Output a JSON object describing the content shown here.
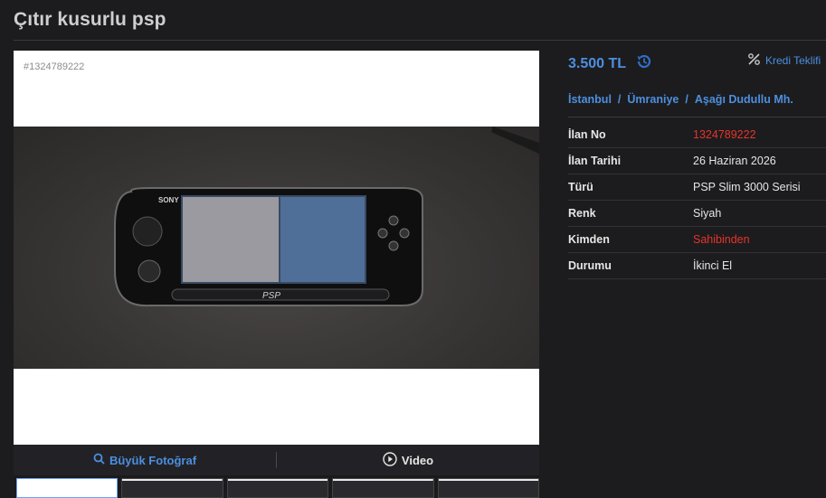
{
  "listing": {
    "title": "Çıtır kusurlu psp",
    "photo_id": "#1324789222",
    "price": "3.500 TL",
    "credit_offer": "Kredi Teklifi",
    "location": {
      "city": "İstanbul",
      "district": "Ümraniye",
      "neighborhood": "Aşağı Dudullu Mh."
    },
    "details": [
      {
        "key": "İlan No",
        "value": "1324789222",
        "highlight": true
      },
      {
        "key": "İlan Tarihi",
        "value": "26 Haziran 2026",
        "highlight": false
      },
      {
        "key": "Türü",
        "value": "PSP Slim 3000 Serisi",
        "highlight": false
      },
      {
        "key": "Renk",
        "value": "Siyah",
        "highlight": false
      },
      {
        "key": "Kimden",
        "value": "Sahibinden",
        "highlight": true
      },
      {
        "key": "Durumu",
        "value": "İkinci El",
        "highlight": false
      }
    ]
  },
  "photo_tabs": {
    "zoom_label": "Büyük Fotoğraf",
    "video_label": "Video"
  },
  "photo_image": {
    "brand_text": "SONY",
    "logo_text": "PSP"
  },
  "icons": {
    "price_history": "history-icon",
    "credit": "percent-icon",
    "zoom": "magnifier-icon",
    "video": "play-icon"
  },
  "colors": {
    "accent": "#4d8fe0",
    "highlight": "#e8332b",
    "background": "#1c1c1e"
  }
}
